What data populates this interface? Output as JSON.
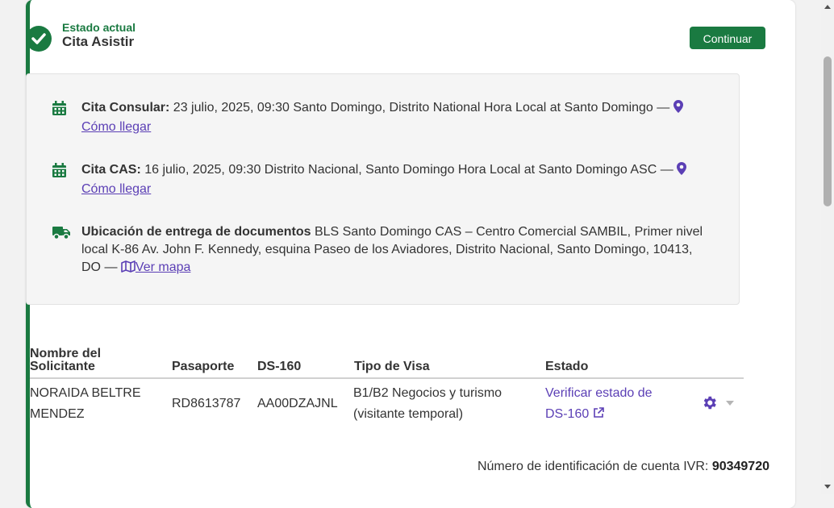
{
  "header": {
    "status_label": "Estado actual",
    "status_value": "Cita Asistir",
    "continue_label": "Continuar"
  },
  "appointments": {
    "consular": {
      "label": "Cita Consular:",
      "details": "23 julio, 2025, 09:30 Santo Domingo, Distrito National Hora Local at Santo Domingo —",
      "link": "Cómo llegar"
    },
    "cas": {
      "label": "Cita CAS:",
      "details": "16 julio, 2025, 09:30 Distrito Nacional, Santo Domingo Hora Local at Santo Domingo ASC —",
      "link": "Cómo llegar"
    },
    "delivery": {
      "label": "Ubicación de entrega de documentos",
      "line1": "BLS Santo Domingo CAS – Centro Comercial SAMBIL, Primer nivel",
      "line2": "local K-86 Av. John F. Kennedy, esquina Paseo de los Aviadores, Distrito Nacional, Santo Domingo, 10413,",
      "line3": "DO —",
      "link": "Ver mapa"
    }
  },
  "table": {
    "headers": {
      "name_line1": "Nombre del",
      "name_line2": "Solicitante",
      "passport": "Pasaporte",
      "ds160": "DS-160",
      "visa_type": "Tipo de Visa",
      "status": "Estado"
    },
    "rows": [
      {
        "name_line1": "NORAIDA BELTRE",
        "name_line2": "MENDEZ",
        "passport": "RD8613787",
        "ds160": "AA00DZAJNL",
        "visa_line1": "B1/B2 Negocios y turismo",
        "visa_line2": "(visitante temporal)",
        "status_line1": "Verificar estado de",
        "status_line2": "DS-160"
      }
    ]
  },
  "ivr": {
    "label": "Número de identificación de cuenta IVR:",
    "value": "90349720"
  },
  "colors": {
    "accent_green": "#1a7a41",
    "link_purple": "#5b3fb5"
  },
  "icons": [
    "check-circle-icon",
    "calendar-icon",
    "map-pin-icon",
    "truck-icon",
    "map-icon",
    "external-link-icon",
    "gear-icon",
    "caret-down-icon"
  ]
}
